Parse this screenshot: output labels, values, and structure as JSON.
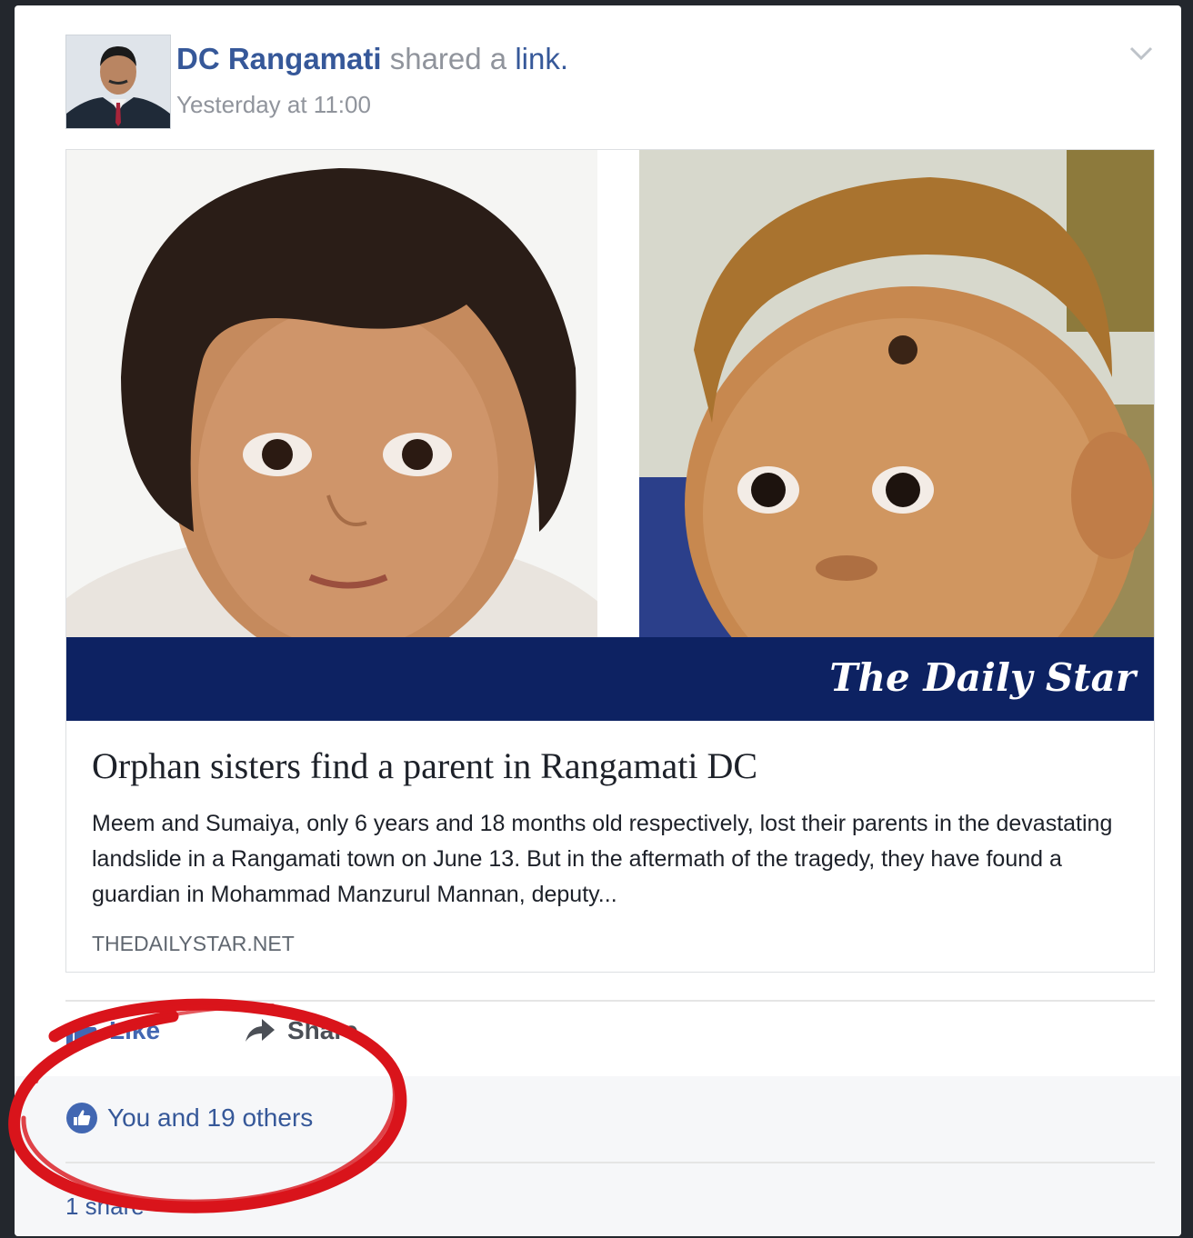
{
  "post": {
    "author": "DC Rangamati",
    "action_text": "shared a",
    "action_link": "link.",
    "timestamp": "Yesterday at 11:00",
    "menu_icon": "chevron-down-icon"
  },
  "link_preview": {
    "masthead": "The Daily Star",
    "headline": "Orphan sisters find a parent in Rangamati DC",
    "summary": "Meem and Sumaiya, only 6 years and 18 months old respectively, lost their parents in the devastating landslide in a Rangamati town on June 13. But in the aftermath of the tragedy, they have found a guardian in Mohammad Manzurul Mannan, deputy...",
    "domain": "THEDAILYSTAR.NET",
    "band_color": "#0d2262"
  },
  "actions": {
    "like_label": "Like",
    "like_icon": "thumbs-up-icon",
    "share_label": "Share",
    "share_icon": "share-arrow-icon"
  },
  "reactions": {
    "summary": "You and 19 others",
    "icon": "like-badge-icon"
  },
  "shares": {
    "label": "1 share"
  },
  "colors": {
    "link_blue": "#365899",
    "like_blue": "#4267b2",
    "annotation_red": "#d9141b"
  }
}
